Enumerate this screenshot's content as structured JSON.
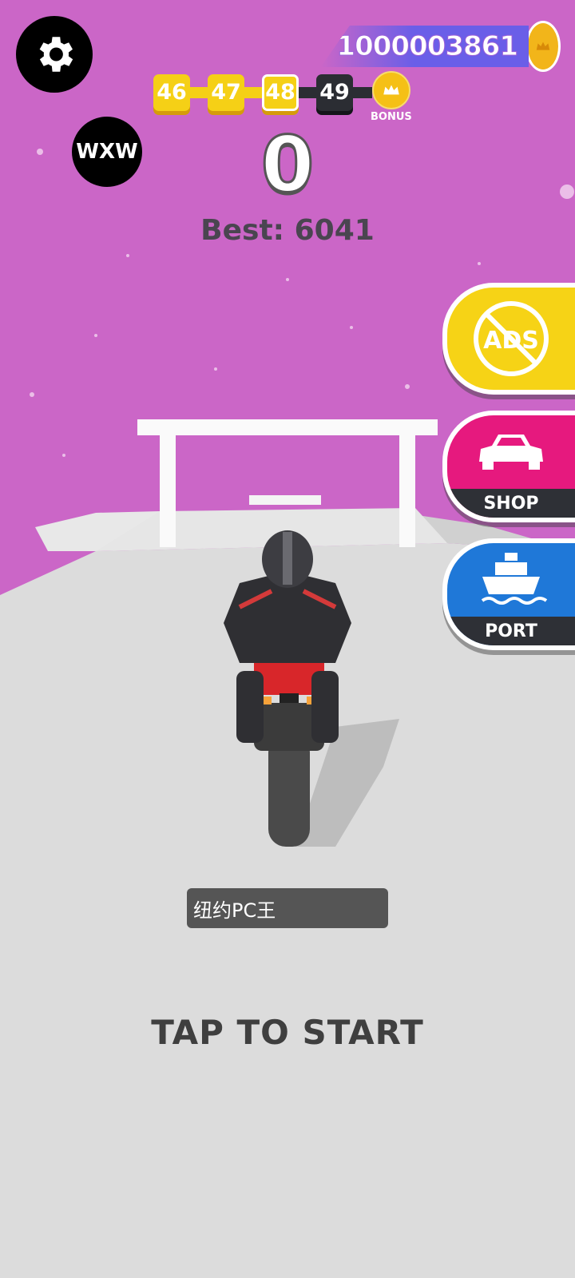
{
  "hud": {
    "coins": "1000003861",
    "levels": [
      "46",
      "47",
      "48",
      "49"
    ],
    "bonus_label": "BONUS",
    "player_avatar": "WXW",
    "score": "0",
    "best_label": "Best:",
    "best_value": "6041"
  },
  "side_buttons": {
    "ads_label": "ADS",
    "shop_label": "SHOP",
    "port_label": "PORT"
  },
  "rider_name": "纽约PC王",
  "start_prompt": "TAP TO START",
  "icons": [
    "gear-icon",
    "coin-icon",
    "crown-icon",
    "no-ads-icon",
    "car-icon",
    "ship-icon"
  ],
  "colors": {
    "sky": "#cb66c7",
    "road": "#dcdcdc",
    "level_done": "#f5d016",
    "level_next": "#2b2d33",
    "shop": "#e6197e",
    "port": "#1f78d8",
    "ads": "#f6d316"
  }
}
